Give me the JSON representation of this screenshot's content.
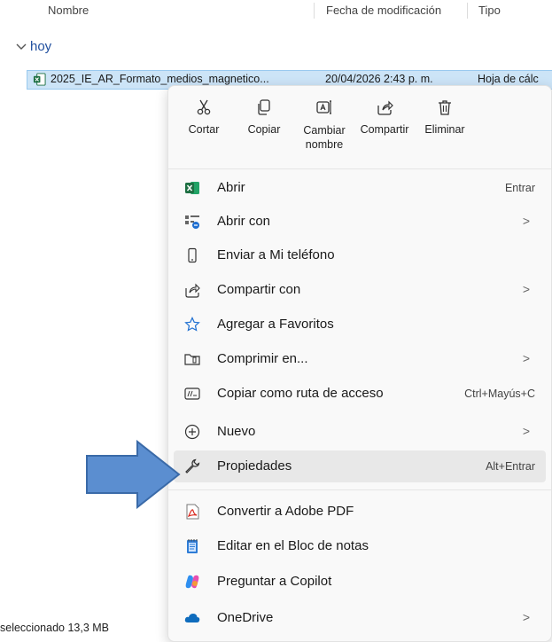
{
  "columns": {
    "name": "Nombre",
    "modified": "Fecha de modificación",
    "type": "Tipo"
  },
  "group": {
    "label": "hoy",
    "chevron": "chevron-down-icon"
  },
  "file": {
    "name": "2025_IE_AR_Formato_medios_magnetico...",
    "date": "20/04/2026 2:43 p. m.",
    "type": "Hoja de cálc",
    "icon": "excel-file-icon"
  },
  "quick_actions": [
    {
      "label": "Cortar",
      "icon": "scissors-icon"
    },
    {
      "label": "Copiar",
      "icon": "copy-icon"
    },
    {
      "label": "Cambiar nombre",
      "icon": "rename-icon"
    },
    {
      "label": "Compartir",
      "icon": "share-icon"
    },
    {
      "label": "Eliminar",
      "icon": "trash-icon"
    }
  ],
  "menu_items": [
    {
      "label": "Abrir",
      "shortcut": "Entrar",
      "submenu": false,
      "icon": "excel-icon"
    },
    {
      "label": "Abrir con",
      "shortcut": "",
      "submenu": true,
      "icon": "open-with-icon"
    },
    {
      "label": "Enviar a Mi teléfono",
      "shortcut": "",
      "submenu": false,
      "icon": "phone-icon"
    },
    {
      "label": "Compartir con",
      "shortcut": "",
      "submenu": true,
      "icon": "share-icon"
    },
    {
      "label": "Agregar a Favoritos",
      "shortcut": "",
      "submenu": false,
      "icon": "star-icon"
    },
    {
      "label": "Comprimir en...",
      "shortcut": "",
      "submenu": true,
      "icon": "zip-folder-icon"
    },
    {
      "label": "Copiar como ruta de acceso",
      "shortcut": "Ctrl+Mayús+C",
      "submenu": false,
      "icon": "path-icon"
    },
    {
      "label": "Nuevo",
      "shortcut": "",
      "submenu": true,
      "icon": "plus-circle-icon"
    },
    {
      "label": "Propiedades",
      "shortcut": "Alt+Entrar",
      "submenu": false,
      "icon": "wrench-icon",
      "highlighted": true
    },
    {
      "label": "Convertir a Adobe PDF",
      "shortcut": "",
      "submenu": false,
      "icon": "adobe-pdf-icon"
    },
    {
      "label": "Editar en el Bloc de notas",
      "shortcut": "",
      "submenu": false,
      "icon": "notepad-icon"
    },
    {
      "label": "Preguntar a Copilot",
      "shortcut": "",
      "submenu": false,
      "icon": "copilot-icon"
    },
    {
      "label": "OneDrive",
      "shortcut": "",
      "submenu": true,
      "icon": "onedrive-icon"
    }
  ],
  "submenu_glyph": ">",
  "status": {
    "text": "seleccionado 13,3 MB"
  },
  "colors": {
    "accent": "#1f4e9e",
    "selection": "#cce4f7",
    "arrow": "#5b8ed0",
    "excel": "#1d6f42"
  }
}
